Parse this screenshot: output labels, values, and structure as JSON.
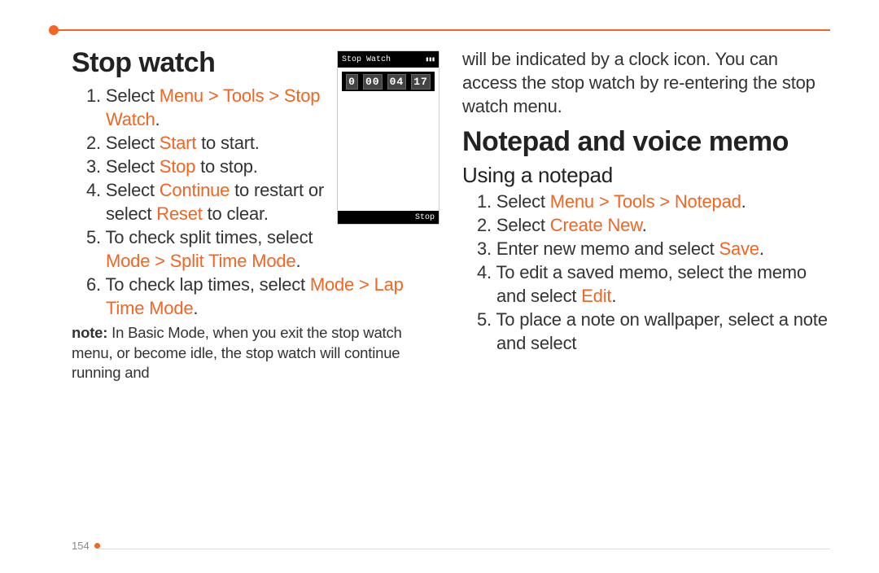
{
  "page_number": "154",
  "left": {
    "heading": "Stop watch",
    "step1_a": "Select ",
    "step1_b": "Menu > Tools > Stop Watch",
    "step1_c": ".",
    "step2_a": "Select ",
    "step2_b": "Start",
    "step2_c": " to start.",
    "step3_a": "Select ",
    "step3_b": "Stop",
    "step3_c": " to stop.",
    "step4_a": "Select ",
    "step4_b": "Continue",
    "step4_c": " to restart or select ",
    "step4_d": "Reset",
    "step4_e": " to clear.",
    "step5_a": "To check split times, select ",
    "step5_b": "Mode > Split Time Mode",
    "step5_c": ".",
    "step6_a": "To check lap times, select ",
    "step6_b": "Mode > Lap Time Mode",
    "step6_c": ".",
    "note_label": "note:",
    "note_text": " In Basic Mode, when you exit the stop watch menu, or become idle, the stop watch will continue running and",
    "phone": {
      "title": "Stop Watch",
      "d0": "0",
      "d1": "00",
      "d2": "04",
      "d3": "17",
      "softkey": "Stop"
    }
  },
  "right": {
    "continuation": "will be indicated by a clock icon. You can access the stop watch by re-entering the stop watch menu.",
    "heading": "Notepad and voice memo",
    "subheading": "Using a notepad",
    "n1_a": "Select ",
    "n1_b": "Menu > Tools > Notepad",
    "n1_c": ".",
    "n2_a": "Select ",
    "n2_b": "Create New",
    "n2_c": ".",
    "n3_a": "Enter new memo and select ",
    "n3_b": "Save",
    "n3_c": ".",
    "n4_a": "To edit a saved memo, select the memo and select ",
    "n4_b": "Edit",
    "n4_c": ".",
    "n5_a": "To place a note on wallpaper, select a note and select"
  }
}
